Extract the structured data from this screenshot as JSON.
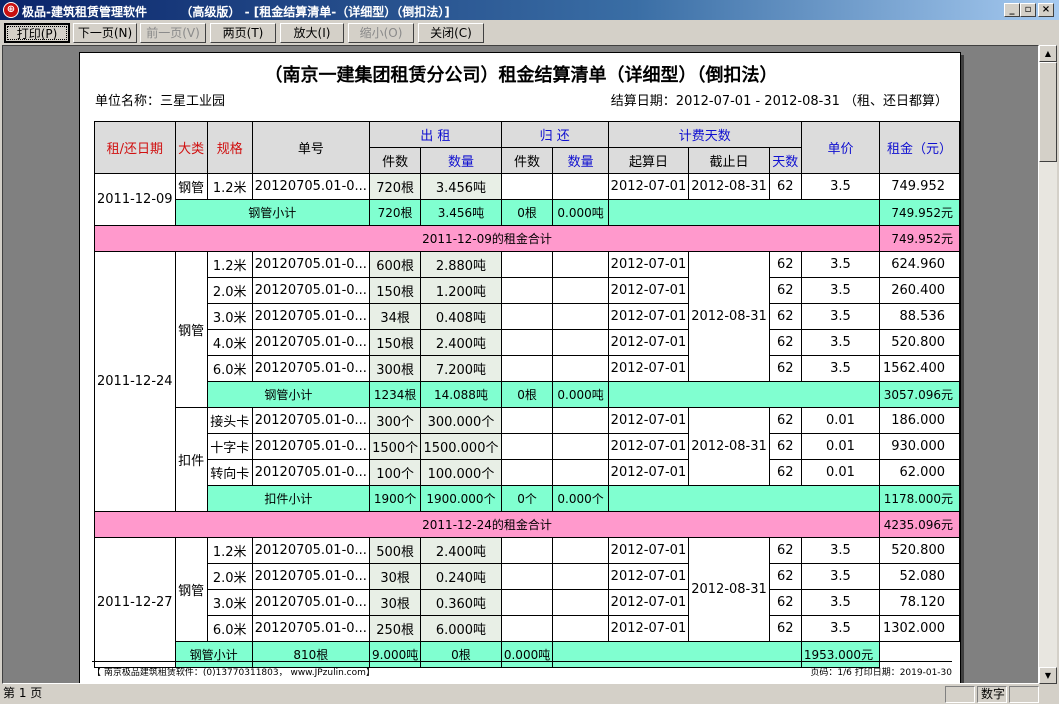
{
  "window": {
    "title": "极品-建筑租赁管理软件        （高级版） - [租金结算清单-（详细型）（倒扣法）]",
    "minimize": "_",
    "restore": "▫",
    "close": "×",
    "accent": "#0a246a"
  },
  "toolbar": {
    "print": "打印(P)",
    "next": "下一页(N)",
    "prev": "前一页(V)",
    "two_pages": "两页(T)",
    "zoom_in": "放大(I)",
    "zoom_out": "缩小(O)",
    "close": "关闭(C)"
  },
  "report": {
    "title": "（南京一建集团租赁分公司）租金结算清单（详细型）（倒扣法）",
    "unit": "单位名称：三星工业园",
    "settle": "结算日期：2012-07-01 - 2012-08-31  （租、还日都算）",
    "headers": {
      "date": "租/还日期",
      "category": "大类",
      "spec": "规格",
      "order": "单号",
      "rent_out": "出  租",
      "return": "归  还",
      "charge_days": "计费天数",
      "count": "件数",
      "qty": "数量",
      "ret_count": "件数",
      "ret_qty": "数量",
      "start": "起算日",
      "end": "截止日",
      "days": "天数",
      "price": "单价",
      "rent": "租金（元）"
    },
    "g1": {
      "date": "2011-12-09",
      "category": "钢管",
      "row": {
        "spec": "1.2米",
        "order": "20120705.01-0...",
        "count": "720根",
        "qty": "3.456吨",
        "start": "2012-07-01",
        "end": "2012-08-31",
        "days": "62",
        "price": "3.5",
        "rent": "749.952"
      },
      "sub": {
        "label": "钢管小计",
        "count": "720根",
        "qty": "3.456吨",
        "ret_count": "0根",
        "ret_qty": "0.000吨",
        "rent": "749.952元"
      },
      "total": {
        "label": "2011-12-09的租金合计",
        "rent": "749.952元"
      }
    },
    "g2": {
      "date": "2011-12-24",
      "cat1": "钢管",
      "end1": "2012-08-31",
      "rows1": [
        {
          "spec": "1.2米",
          "order": "20120705.01-0...",
          "count": "600根",
          "qty": "2.880吨",
          "start": "2012-07-01",
          "days": "62",
          "price": "3.5",
          "rent": "624.960"
        },
        {
          "spec": "2.0米",
          "order": "20120705.01-0...",
          "count": "150根",
          "qty": "1.200吨",
          "start": "2012-07-01",
          "days": "62",
          "price": "3.5",
          "rent": "260.400"
        },
        {
          "spec": "3.0米",
          "order": "20120705.01-0...",
          "count": "34根",
          "qty": "0.408吨",
          "start": "2012-07-01",
          "days": "62",
          "price": "3.5",
          "rent": "88.536"
        },
        {
          "spec": "4.0米",
          "order": "20120705.01-0...",
          "count": "150根",
          "qty": "2.400吨",
          "start": "2012-07-01",
          "days": "62",
          "price": "3.5",
          "rent": "520.800"
        },
        {
          "spec": "6.0米",
          "order": "20120705.01-0...",
          "count": "300根",
          "qty": "7.200吨",
          "start": "2012-07-01",
          "days": "62",
          "price": "3.5",
          "rent": "1562.400"
        }
      ],
      "sub1": {
        "label": "钢管小计",
        "count": "1234根",
        "qty": "14.088吨",
        "ret_count": "0根",
        "ret_qty": "0.000吨",
        "rent": "3057.096元"
      },
      "cat2": "扣件",
      "end2": "2012-08-31",
      "rows2": [
        {
          "spec": "接头卡",
          "order": "20120705.01-0...",
          "count": "300个",
          "qty": "300.000个",
          "start": "2012-07-01",
          "days": "62",
          "price": "0.01",
          "rent": "186.000"
        },
        {
          "spec": "十字卡",
          "order": "20120705.01-0...",
          "count": "1500个",
          "qty": "1500.000个",
          "start": "2012-07-01",
          "days": "62",
          "price": "0.01",
          "rent": "930.000"
        },
        {
          "spec": "转向卡",
          "order": "20120705.01-0...",
          "count": "100个",
          "qty": "100.000个",
          "start": "2012-07-01",
          "days": "62",
          "price": "0.01",
          "rent": "62.000"
        }
      ],
      "sub2": {
        "label": "扣件小计",
        "count": "1900个",
        "qty": "1900.000个",
        "ret_count": "0个",
        "ret_qty": "0.000个",
        "rent": "1178.000元"
      },
      "total": {
        "label": "2011-12-24的租金合计",
        "rent": "4235.096元"
      }
    },
    "g3": {
      "date": "2011-12-27",
      "category": "钢管",
      "end": "2012-08-31",
      "rows": [
        {
          "spec": "1.2米",
          "order": "20120705.01-0...",
          "count": "500根",
          "qty": "2.400吨",
          "start": "2012-07-01",
          "days": "62",
          "price": "3.5",
          "rent": "520.800"
        },
        {
          "spec": "2.0米",
          "order": "20120705.01-0...",
          "count": "30根",
          "qty": "0.240吨",
          "start": "2012-07-01",
          "days": "62",
          "price": "3.5",
          "rent": "52.080"
        },
        {
          "spec": "3.0米",
          "order": "20120705.01-0...",
          "count": "30根",
          "qty": "0.360吨",
          "start": "2012-07-01",
          "days": "62",
          "price": "3.5",
          "rent": "78.120"
        },
        {
          "spec": "6.0米",
          "order": "20120705.01-0...",
          "count": "250根",
          "qty": "6.000吨",
          "start": "2012-07-01",
          "days": "62",
          "price": "3.5",
          "rent": "1302.000"
        }
      ],
      "sub": {
        "label": "钢管小计",
        "count": "810根",
        "qty": "9.000吨",
        "ret_count": "0根",
        "ret_qty": "0.000吨",
        "rent": "1953.000元"
      }
    },
    "footer_left": "【 南京极品建筑租赁软件：(0)13770311803， www.JPzulin.com】",
    "footer_right": "页码：1/6     打印日期：2019-01-30"
  },
  "status": {
    "page": "第 1 页",
    "mode": "数字"
  }
}
